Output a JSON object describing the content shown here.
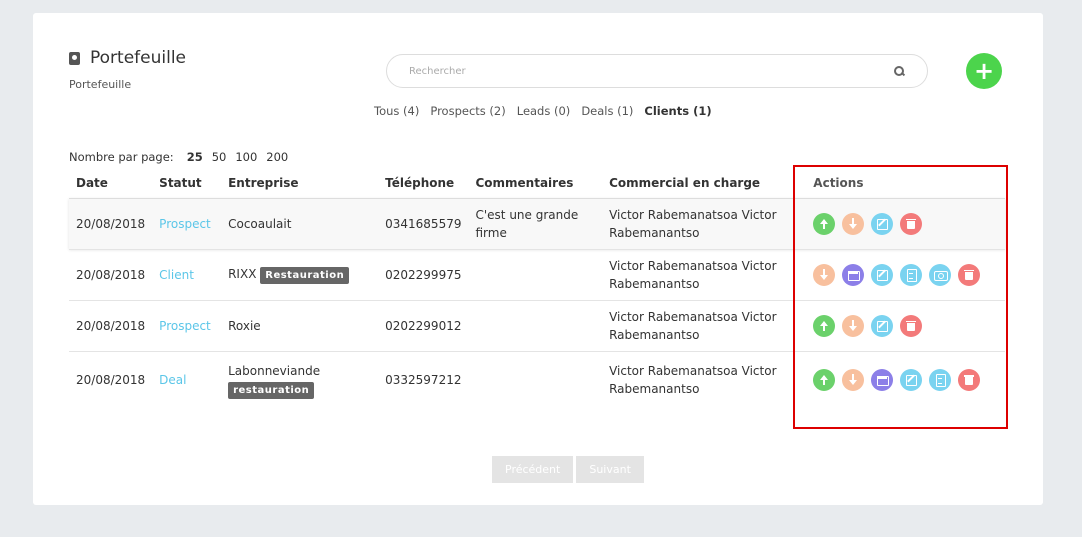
{
  "header": {
    "title": "Portefeuille",
    "subtitle": "Portefeuille",
    "search_placeholder": "Rechercher",
    "add_label": "+"
  },
  "filters": [
    {
      "label": "Tous (4)",
      "active": false
    },
    {
      "label": "Prospects (2)",
      "active": false
    },
    {
      "label": "Leads (0)",
      "active": false
    },
    {
      "label": "Deals (1)",
      "active": false
    },
    {
      "label": "Clients (1)",
      "active": true
    }
  ],
  "per_page": {
    "label": "Nombre par page:",
    "options": [
      "25",
      "50",
      "100",
      "200"
    ],
    "selected": "25"
  },
  "table": {
    "columns": [
      "Date",
      "Statut",
      "Entreprise",
      "Téléphone",
      "Commentaires",
      "Commercial en charge",
      "Actions"
    ],
    "rows": [
      {
        "date": "20/08/2018",
        "status": "Prospect",
        "company": "Cocoaulait",
        "tag": "",
        "phone": "0341685579",
        "comment": "C'est une grande firme",
        "commercial": "Victor Rabemanatsoa Victor Rabemanantso",
        "actions": [
          "up",
          "down",
          "edit",
          "del"
        ]
      },
      {
        "date": "20/08/2018",
        "status": "Client",
        "company": "RIXX",
        "tag": "Restauration",
        "phone": "0202299975",
        "comment": "",
        "commercial": "Victor Rabemanatsoa Victor Rabemanantso",
        "actions": [
          "down",
          "cal",
          "edit",
          "doc",
          "cam",
          "del"
        ]
      },
      {
        "date": "20/08/2018",
        "status": "Prospect",
        "company": "Roxie",
        "tag": "",
        "phone": "0202299012",
        "comment": "",
        "commercial": "Victor Rabemanatsoa Victor Rabemanantso",
        "actions": [
          "up",
          "down",
          "edit",
          "del"
        ]
      },
      {
        "date": "20/08/2018",
        "status": "Deal",
        "company": "Labonneviande",
        "tag": "restauration",
        "phone": "0332597212",
        "comment": "",
        "commercial": "Victor Rabemanatsoa Victor Rabemanantso",
        "actions": [
          "up",
          "down",
          "cal",
          "edit",
          "doc",
          "del"
        ]
      }
    ]
  },
  "pager": {
    "prev": "Précédent",
    "next": "Suivant"
  },
  "colors": {
    "status_link": "#5bc6e8",
    "add_button": "#4cd44c",
    "highlight": "#dd0000"
  }
}
